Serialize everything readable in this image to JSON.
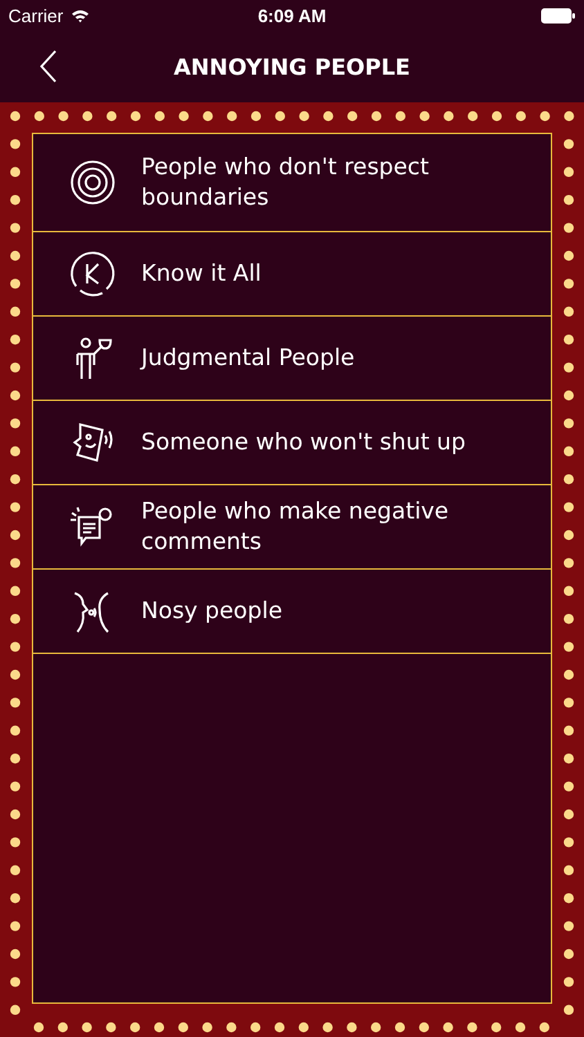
{
  "status_bar": {
    "carrier": "Carrier",
    "time": "6:09 AM"
  },
  "nav": {
    "title": "ANNOYING PEOPLE"
  },
  "items": [
    {
      "label": "People who don't respect boundaries"
    },
    {
      "label": "Know it All"
    },
    {
      "label": "Judgmental People"
    },
    {
      "label": "Someone who won't shut up"
    },
    {
      "label": "People who make negative comments"
    },
    {
      "label": "Nosy people"
    }
  ]
}
